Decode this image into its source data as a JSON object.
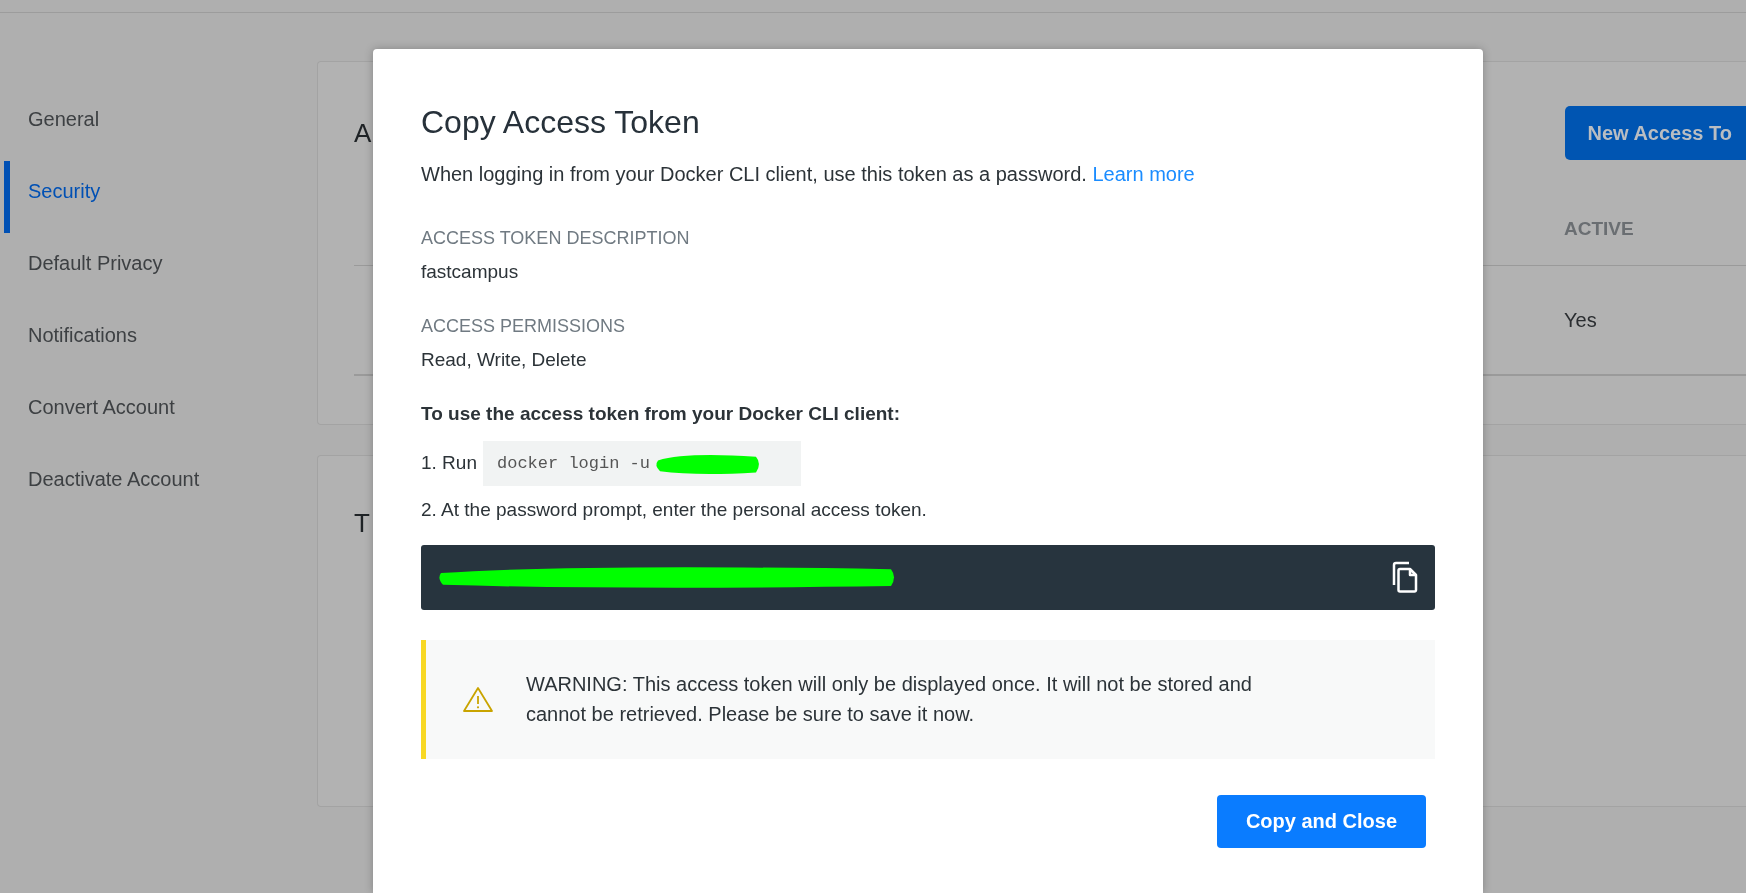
{
  "sidebar": {
    "items": [
      {
        "label": "General",
        "selected": false
      },
      {
        "label": "Security",
        "selected": true
      },
      {
        "label": "Default Privacy",
        "selected": false
      },
      {
        "label": "Notifications",
        "selected": false
      },
      {
        "label": "Convert Account",
        "selected": false
      },
      {
        "label": "Deactivate Account",
        "selected": false
      }
    ]
  },
  "cards": [
    {
      "title": "A",
      "button": "New Access To",
      "table": {
        "columns": [
          "ACTIVE"
        ],
        "rows": [
          [
            "Yes"
          ]
        ]
      }
    },
    {
      "title": "T"
    }
  ],
  "modal": {
    "title": "Copy Access Token",
    "description": "When logging in from your Docker CLI client, use this token as a password.",
    "link": "Learn more",
    "fields": [
      {
        "label": "ACCESS TOKEN DESCRIPTION",
        "value": "fastcampus"
      },
      {
        "label": "ACCESS PERMISSIONS",
        "value": "Read, Write, Delete"
      }
    ],
    "instructions_heading": "To use the access token from your Docker CLI client:",
    "steps": [
      {
        "kind": "command",
        "text": "1. Run",
        "code": "docker login -u"
      },
      {
        "kind": "text",
        "text": "2. At the password prompt, enter the personal access token."
      }
    ],
    "warning": "WARNING: This access token will only be displayed once. It will not be stored and cannot be retrieved. Please be sure to save it now.",
    "button": "Copy and Close"
  }
}
